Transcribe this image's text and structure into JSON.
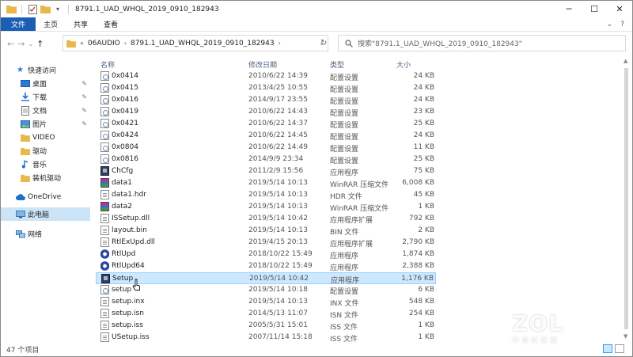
{
  "window": {
    "title": "8791.1_UAD_WHQL_2019_0910_182943",
    "controls": {
      "minimize": "─",
      "maximize": "☐",
      "close": "✕"
    }
  },
  "ribbon": {
    "tabs": [
      "文件",
      "主页",
      "共享",
      "查看"
    ],
    "expand_icon": "chevron-down",
    "help_icon": "?"
  },
  "address": {
    "chevron": "«",
    "crumbs": [
      "06AUDIO",
      "8791.1_UAD_WHQL_2019_0910_182943"
    ],
    "refresh_icon": "↻"
  },
  "search": {
    "placeholder": "搜索\"8791.1_UAD_WHQL_2019_0910_182943\""
  },
  "nav_pane": {
    "quick_access": "快速访问",
    "items": [
      {
        "label": "桌面",
        "icon": "desktop",
        "pinned": true
      },
      {
        "label": "下载",
        "icon": "download",
        "pinned": true
      },
      {
        "label": "文档",
        "icon": "document",
        "pinned": true
      },
      {
        "label": "图片",
        "icon": "picture",
        "pinned": true
      },
      {
        "label": "VIDEO",
        "icon": "folder",
        "pinned": false
      },
      {
        "label": "驱动",
        "icon": "folder",
        "pinned": false
      },
      {
        "label": "音乐",
        "icon": "music",
        "pinned": false
      },
      {
        "label": "装机驱动",
        "icon": "folder",
        "pinned": false
      }
    ],
    "onedrive": "OneDrive",
    "this_pc": "此电脑",
    "network": "网络"
  },
  "columns": {
    "name": "名称",
    "date": "修改日期",
    "type": "类型",
    "size": "大小"
  },
  "files": [
    {
      "name": "0x0414",
      "date": "2010/6/22 14:39",
      "type": "配置设置",
      "size": "24 KB",
      "icon": "cfg"
    },
    {
      "name": "0x0415",
      "date": "2013/4/25 10:55",
      "type": "配置设置",
      "size": "24 KB",
      "icon": "cfg"
    },
    {
      "name": "0x0416",
      "date": "2014/9/17 23:55",
      "type": "配置设置",
      "size": "24 KB",
      "icon": "cfg"
    },
    {
      "name": "0x0419",
      "date": "2010/6/22 14:43",
      "type": "配置设置",
      "size": "23 KB",
      "icon": "cfg"
    },
    {
      "name": "0x0421",
      "date": "2010/6/22 14:37",
      "type": "配置设置",
      "size": "25 KB",
      "icon": "cfg"
    },
    {
      "name": "0x0424",
      "date": "2010/6/22 14:45",
      "type": "配置设置",
      "size": "24 KB",
      "icon": "cfg"
    },
    {
      "name": "0x0804",
      "date": "2010/6/22 14:49",
      "type": "配置设置",
      "size": "11 KB",
      "icon": "cfg"
    },
    {
      "name": "0x0816",
      "date": "2014/9/9 23:34",
      "type": "配置设置",
      "size": "25 KB",
      "icon": "cfg"
    },
    {
      "name": "ChCfg",
      "date": "2011/2/9 15:56",
      "type": "应用程序",
      "size": "75 KB",
      "icon": "app"
    },
    {
      "name": "data1",
      "date": "2019/5/14 10:13",
      "type": "WinRAR 压缩文件",
      "size": "6,008 KB",
      "icon": "rar"
    },
    {
      "name": "data1.hdr",
      "date": "2019/5/14 10:13",
      "type": "HDR 文件",
      "size": "45 KB",
      "icon": "doc"
    },
    {
      "name": "data2",
      "date": "2019/5/14 10:13",
      "type": "WinRAR 压缩文件",
      "size": "1 KB",
      "icon": "rar"
    },
    {
      "name": "ISSetup.dll",
      "date": "2019/5/14 10:42",
      "type": "应用程序扩展",
      "size": "792 KB",
      "icon": "doc"
    },
    {
      "name": "layout.bin",
      "date": "2019/5/14 10:13",
      "type": "BIN 文件",
      "size": "2 KB",
      "icon": "doc"
    },
    {
      "name": "RtlExUpd.dll",
      "date": "2019/4/15 20:13",
      "type": "应用程序扩展",
      "size": "2,790 KB",
      "icon": "doc"
    },
    {
      "name": "RtlUpd",
      "date": "2018/10/22 15:49",
      "type": "应用程序",
      "size": "1,874 KB",
      "icon": "snd"
    },
    {
      "name": "RtlUpd64",
      "date": "2018/10/22 15:49",
      "type": "应用程序",
      "size": "2,388 KB",
      "icon": "snd"
    },
    {
      "name": "Setup",
      "date": "2019/5/14 10:42",
      "type": "应用程序",
      "size": "1,176 KB",
      "icon": "app",
      "selected": true
    },
    {
      "name": "setup",
      "date": "2019/5/14 10:18",
      "type": "配置设置",
      "size": "6 KB",
      "icon": "cfg"
    },
    {
      "name": "setup.inx",
      "date": "2019/5/14 10:13",
      "type": "INX 文件",
      "size": "548 KB",
      "icon": "doc"
    },
    {
      "name": "setup.isn",
      "date": "2014/5/13 11:07",
      "type": "ISN 文件",
      "size": "254 KB",
      "icon": "doc"
    },
    {
      "name": "setup.iss",
      "date": "2005/5/31 15:01",
      "type": "ISS 文件",
      "size": "1 KB",
      "icon": "doc"
    },
    {
      "name": "USetup.iss",
      "date": "2007/11/14 15:18",
      "type": "ISS 文件",
      "size": "1 KB",
      "icon": "doc"
    }
  ],
  "status": {
    "count": "47 个项目"
  },
  "watermark": {
    "big": "ZOL",
    "small": "中关村在线"
  }
}
